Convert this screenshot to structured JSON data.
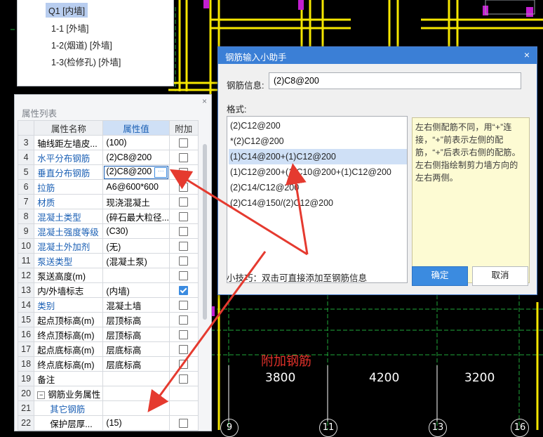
{
  "component_list": {
    "items": [
      "Q1 [内墙]",
      "1-1 [外墙]",
      "1-2(烟道) [外墙]",
      "1-3(检修孔) [外墙]"
    ],
    "selected_index": 0
  },
  "property_panel": {
    "title": "属性列表",
    "close_glyph": "×",
    "headers": {
      "name": "属性名称",
      "value": "属性值",
      "add": "附加"
    },
    "rows": [
      {
        "num": "3",
        "name": "轴线距左墙皮...",
        "value": "(100)",
        "checked": false,
        "blue": false
      },
      {
        "num": "4",
        "name": "水平分布钢筋",
        "value": "(2)C8@200",
        "checked": false,
        "blue": true
      },
      {
        "num": "5",
        "name": "垂直分布钢筋",
        "value": "(2)C8@200",
        "checked": false,
        "blue": true
      },
      {
        "num": "6",
        "name": "拉筋",
        "value": "A6@600*600",
        "checked": false,
        "blue": true
      },
      {
        "num": "7",
        "name": "材质",
        "value": "现浇混凝土",
        "checked": false,
        "blue": true
      },
      {
        "num": "8",
        "name": "混凝土类型",
        "value": "(碎石最大粒径...",
        "checked": false,
        "blue": true
      },
      {
        "num": "9",
        "name": "混凝土强度等级",
        "value": "(C30)",
        "checked": false,
        "blue": true
      },
      {
        "num": "10",
        "name": "混凝土外加剂",
        "value": "(无)",
        "checked": false,
        "blue": true
      },
      {
        "num": "11",
        "name": "泵送类型",
        "value": "(混凝土泵)",
        "checked": false,
        "blue": true
      },
      {
        "num": "12",
        "name": "泵送高度(m)",
        "value": "",
        "checked": false,
        "blue": false
      },
      {
        "num": "13",
        "name": "内/外墙标志",
        "value": "(内墙)",
        "checked": true,
        "blue": false
      },
      {
        "num": "14",
        "name": "类别",
        "value": "混凝土墙",
        "checked": false,
        "blue": true
      },
      {
        "num": "15",
        "name": "起点顶标高(m)",
        "value": "层顶标高",
        "checked": false,
        "blue": false
      },
      {
        "num": "16",
        "name": "终点顶标高(m)",
        "value": "层顶标高",
        "checked": false,
        "blue": false
      },
      {
        "num": "17",
        "name": "起点底标高(m)",
        "value": "层底标高",
        "checked": false,
        "blue": false
      },
      {
        "num": "18",
        "name": "终点底标高(m)",
        "value": "层底标高",
        "checked": false,
        "blue": false
      },
      {
        "num": "19",
        "name": "备注",
        "value": "",
        "checked": false,
        "blue": false
      },
      {
        "num": "20",
        "name": "钢筋业务属性",
        "value": "",
        "checked": null,
        "blue": false,
        "group": true
      },
      {
        "num": "21",
        "name": "其它钢筋",
        "value": "",
        "checked": null,
        "blue": true,
        "indent": true
      },
      {
        "num": "22",
        "name": "保护层厚...",
        "value": "(15)",
        "checked": false,
        "blue": false,
        "indent": true
      }
    ],
    "selected_row": "5",
    "more_glyph": "···",
    "collapse_glyph": "−"
  },
  "dialog": {
    "title": "钢筋输入小助手",
    "close_glyph": "×",
    "info_label": "钢筋信息:",
    "info_value": "(2)C8@200",
    "format_label": "格式:",
    "formats": [
      "(2)C12@200",
      "*(2)C12@200",
      "(1)C14@200+(1)C12@200",
      "(1)C12@200+(1)C10@200+(1)C12@200",
      "(2)C14/C12@200",
      "(2)C14@150/(2)C12@200"
    ],
    "selected_format": 2,
    "help_text": "左右侧配筋不同，用“+”连接，“+”前表示左侧的配筋，“+”后表示右侧的配筋。左右侧指绘制剪力墙方向的左右两侧。",
    "tip": "小技巧：双击可直接添加至钢筋信息",
    "ok_label": "确定",
    "cancel_label": "取消"
  },
  "cad": {
    "dimensions": [
      "3800",
      "4200",
      "3200"
    ],
    "annotation": "附加钢筋",
    "axis_labels": [
      "9",
      "11",
      "13",
      "16"
    ]
  },
  "colors": {
    "accent": "#3b7fd6",
    "arrow": "#e53a2f",
    "wall_yellow": "#f5e600",
    "column_magenta": "#c21fd0",
    "grid_green": "#1fa83a"
  }
}
